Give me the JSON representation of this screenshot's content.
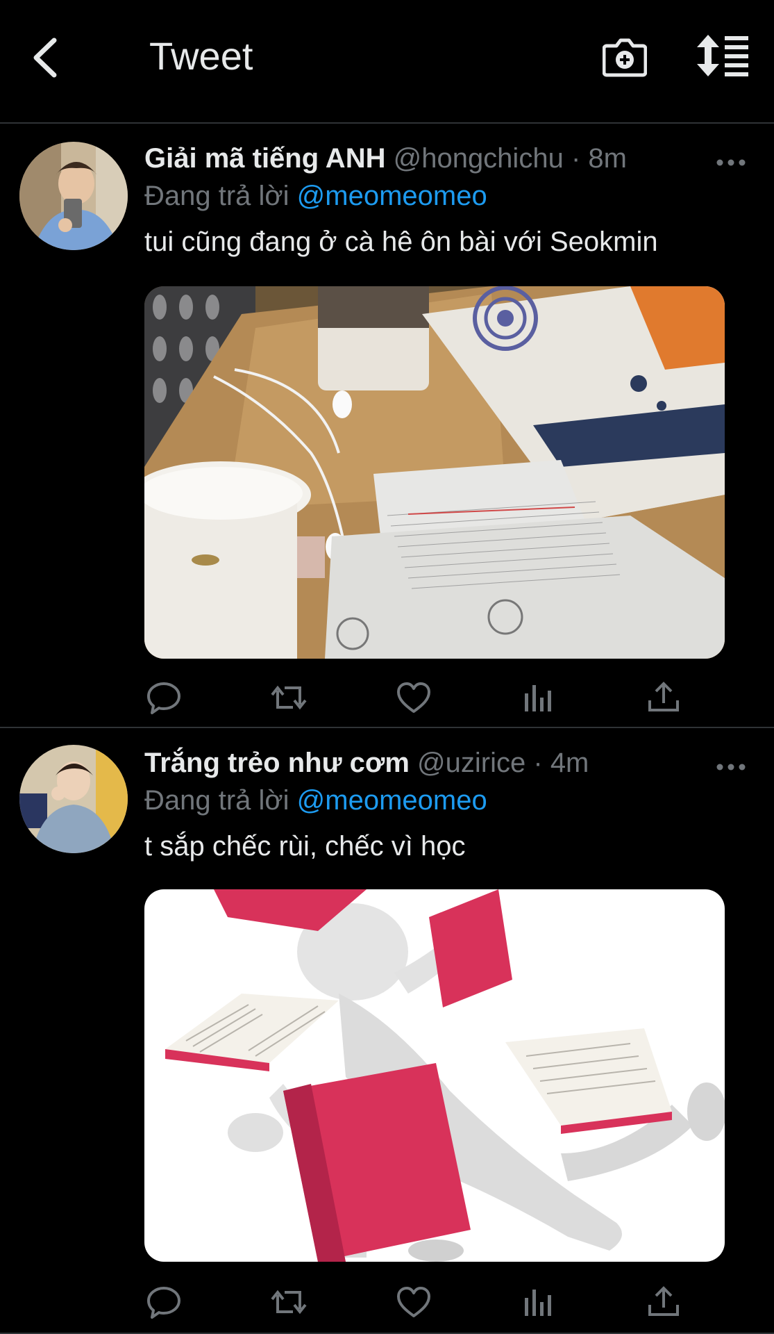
{
  "header": {
    "title": "Tweet",
    "back_icon": "chevron-left-icon",
    "camera_icon": "camera-plus-icon",
    "sort_icon": "sort-lines-icon"
  },
  "colors": {
    "background": "#000000",
    "text": "#e7e9ea",
    "secondary": "#71767b",
    "link": "#1d9bf0",
    "divider": "#2f3336"
  },
  "tweets": [
    {
      "display_name": "Giải mã tiếng ANH",
      "handle": "@hongchichu",
      "separator": "·",
      "time": "8m",
      "reply_prefix": "Đang trả lời",
      "reply_to": "@meomeomeo",
      "text": "tui cũng đang ở cà hê ôn bài với Seokmin",
      "media_description_icon": "photo-icon"
    },
    {
      "display_name": "Trắng trẻo như cơm",
      "handle": "@uzirice",
      "separator": "·",
      "time": "4m",
      "reply_prefix": "Đang trả lời",
      "reply_to": "@meomeomeo",
      "text": "t sắp chếc rùi, chếc vì học",
      "media_description_icon": "photo-icon"
    }
  ],
  "action_icons": [
    "reply-icon",
    "retweet-icon",
    "like-icon",
    "analytics-icon",
    "share-icon"
  ]
}
